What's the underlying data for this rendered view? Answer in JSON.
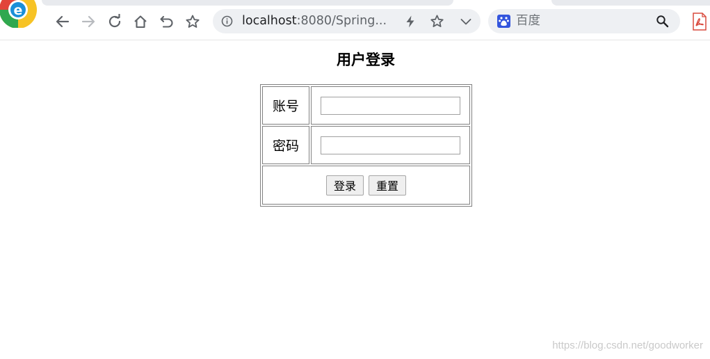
{
  "browser": {
    "address_host": "localhost",
    "address_rest": ":8080/Spring...",
    "search_placeholder": "百度"
  },
  "page": {
    "title": "用户登录"
  },
  "form": {
    "account_label": "账号",
    "password_label": "密码",
    "account_value": "",
    "password_value": "",
    "login_button": "登录",
    "reset_button": "重置"
  },
  "watermark": "https://blog.csdn.net/goodworker",
  "colors": {
    "address_bar_bg": "#eef0f3",
    "table_border": "#808080",
    "search_engine_icon": "#3355dd"
  }
}
